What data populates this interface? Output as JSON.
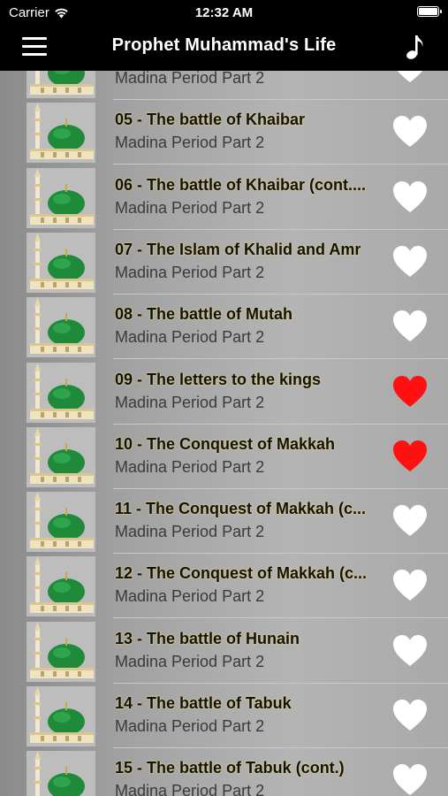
{
  "status_bar": {
    "carrier": "Carrier",
    "time": "12:32 AM"
  },
  "navbar": {
    "title": "Prophet Muhammad's Life",
    "menu_icon": "hamburger-menu-icon",
    "music_icon": "music-note-icon"
  },
  "colors": {
    "favorite_on": "#ff1111",
    "favorite_off": "#ffffff",
    "subtitle": "#3a3a3a"
  },
  "items": [
    {
      "title": "",
      "subtitle": "Madina Period Part 2",
      "favorite": false
    },
    {
      "title": "05 - The battle of Khaibar",
      "subtitle": "Madina Period Part 2",
      "favorite": false
    },
    {
      "title": "06 - The battle of Khaibar (cont....",
      "subtitle": "Madina Period Part 2",
      "favorite": false
    },
    {
      "title": "07 - The Islam of Khalid and Amr",
      "subtitle": "Madina Period Part 2",
      "favorite": false
    },
    {
      "title": "08 - The battle of Mutah",
      "subtitle": "Madina Period Part 2",
      "favorite": false
    },
    {
      "title": "09 - The letters to the kings",
      "subtitle": "Madina Period Part 2",
      "favorite": true
    },
    {
      "title": "10 - The Conquest of Makkah",
      "subtitle": "Madina Period Part 2",
      "favorite": true
    },
    {
      "title": "11 - The Conquest of Makkah (c...",
      "subtitle": "Madina Period Part 2",
      "favorite": false
    },
    {
      "title": "12 - The Conquest of Makkah (c...",
      "subtitle": "Madina Period Part 2",
      "favorite": false
    },
    {
      "title": "13 - The battle of Hunain",
      "subtitle": "Madina Period Part 2",
      "favorite": false
    },
    {
      "title": "14 - The battle of Tabuk",
      "subtitle": "Madina Period Part 2",
      "favorite": false
    },
    {
      "title": "15 - The battle of Tabuk (cont.)",
      "subtitle": "Madina Period Part 2",
      "favorite": false
    }
  ]
}
